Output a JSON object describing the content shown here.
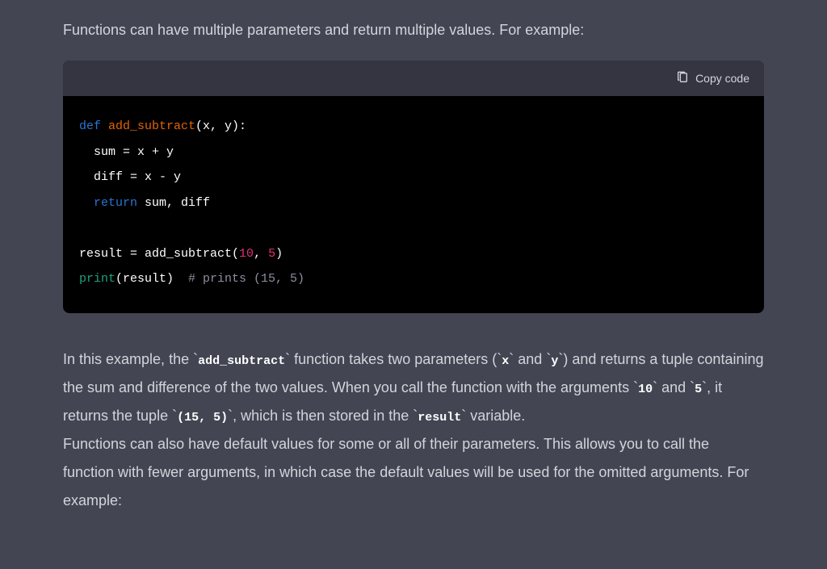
{
  "intro": "Functions can have multiple parameters and return multiple values. For example:",
  "copy_label": "Copy code",
  "code": {
    "l1_def": "def",
    "l1_fn": " add_subtract",
    "l1_rest": "(x, y):",
    "l2": "  sum = x + y",
    "l3": "  diff = x - y",
    "l4_ret": "  return",
    "l4_rest": " sum, diff",
    "l5_a": "result = add_subtract(",
    "l5_n1": "10",
    "l5_b": ", ",
    "l5_n2": "5",
    "l5_c": ")",
    "l6_print": "print",
    "l6_rest": "(result)  ",
    "l6_cmt": "# prints (15, 5)"
  },
  "explain": {
    "t1": "In this example, the ",
    "c1": "add_subtract",
    "t2": " function takes two parameters (",
    "c2": "x",
    "t3": " and ",
    "c3": "y",
    "t4": ") and returns a tuple containing the sum and difference of the two values. When you call the function with the arguments ",
    "c4": "10",
    "t5": " and ",
    "c5": "5",
    "t6": ", it returns the tuple ",
    "c6": "(15, 5)",
    "t7": ", which is then stored in the ",
    "c7": "result",
    "t8": " variable."
  },
  "outro": "Functions can also have default values for some or all of their parameters. This allows you to call the function with fewer arguments, in which case the default values will be used for the omitted arguments. For example:"
}
